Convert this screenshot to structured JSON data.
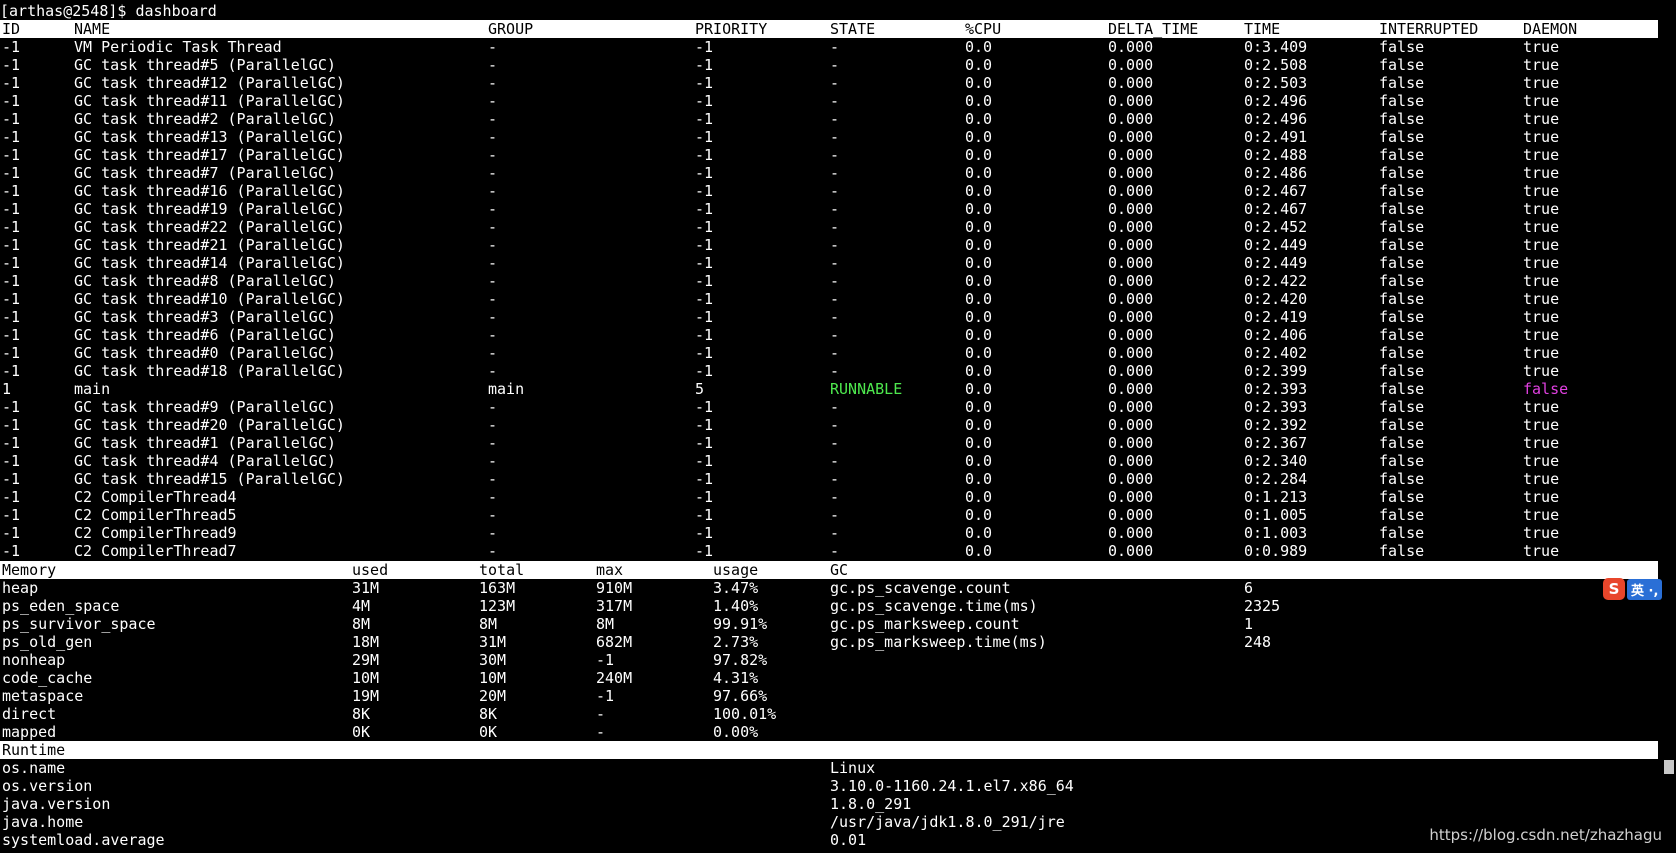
{
  "prompt": "[arthas@2548]$ dashboard",
  "threads": {
    "headers": [
      "ID",
      "NAME",
      "GROUP",
      "PRIORITY",
      "STATE",
      "%CPU",
      "DELTA_TIME",
      "TIME",
      "INTERRUPTED",
      "DAEMON"
    ],
    "rows": [
      [
        "-1",
        "VM Periodic Task Thread",
        "-",
        "-1",
        "-",
        "0.0",
        "0.000",
        "0:3.409",
        "false",
        "true"
      ],
      [
        "-1",
        "GC task thread#5 (ParallelGC)",
        "-",
        "-1",
        "-",
        "0.0",
        "0.000",
        "0:2.508",
        "false",
        "true"
      ],
      [
        "-1",
        "GC task thread#12 (ParallelGC)",
        "-",
        "-1",
        "-",
        "0.0",
        "0.000",
        "0:2.503",
        "false",
        "true"
      ],
      [
        "-1",
        "GC task thread#11 (ParallelGC)",
        "-",
        "-1",
        "-",
        "0.0",
        "0.000",
        "0:2.496",
        "false",
        "true"
      ],
      [
        "-1",
        "GC task thread#2 (ParallelGC)",
        "-",
        "-1",
        "-",
        "0.0",
        "0.000",
        "0:2.496",
        "false",
        "true"
      ],
      [
        "-1",
        "GC task thread#13 (ParallelGC)",
        "-",
        "-1",
        "-",
        "0.0",
        "0.000",
        "0:2.491",
        "false",
        "true"
      ],
      [
        "-1",
        "GC task thread#17 (ParallelGC)",
        "-",
        "-1",
        "-",
        "0.0",
        "0.000",
        "0:2.488",
        "false",
        "true"
      ],
      [
        "-1",
        "GC task thread#7 (ParallelGC)",
        "-",
        "-1",
        "-",
        "0.0",
        "0.000",
        "0:2.486",
        "false",
        "true"
      ],
      [
        "-1",
        "GC task thread#16 (ParallelGC)",
        "-",
        "-1",
        "-",
        "0.0",
        "0.000",
        "0:2.467",
        "false",
        "true"
      ],
      [
        "-1",
        "GC task thread#19 (ParallelGC)",
        "-",
        "-1",
        "-",
        "0.0",
        "0.000",
        "0:2.467",
        "false",
        "true"
      ],
      [
        "-1",
        "GC task thread#22 (ParallelGC)",
        "-",
        "-1",
        "-",
        "0.0",
        "0.000",
        "0:2.452",
        "false",
        "true"
      ],
      [
        "-1",
        "GC task thread#21 (ParallelGC)",
        "-",
        "-1",
        "-",
        "0.0",
        "0.000",
        "0:2.449",
        "false",
        "true"
      ],
      [
        "-1",
        "GC task thread#14 (ParallelGC)",
        "-",
        "-1",
        "-",
        "0.0",
        "0.000",
        "0:2.449",
        "false",
        "true"
      ],
      [
        "-1",
        "GC task thread#8 (ParallelGC)",
        "-",
        "-1",
        "-",
        "0.0",
        "0.000",
        "0:2.422",
        "false",
        "true"
      ],
      [
        "-1",
        "GC task thread#10 (ParallelGC)",
        "-",
        "-1",
        "-",
        "0.0",
        "0.000",
        "0:2.420",
        "false",
        "true"
      ],
      [
        "-1",
        "GC task thread#3 (ParallelGC)",
        "-",
        "-1",
        "-",
        "0.0",
        "0.000",
        "0:2.419",
        "false",
        "true"
      ],
      [
        "-1",
        "GC task thread#6 (ParallelGC)",
        "-",
        "-1",
        "-",
        "0.0",
        "0.000",
        "0:2.406",
        "false",
        "true"
      ],
      [
        "-1",
        "GC task thread#0 (ParallelGC)",
        "-",
        "-1",
        "-",
        "0.0",
        "0.000",
        "0:2.402",
        "false",
        "true"
      ],
      [
        "-1",
        "GC task thread#18 (ParallelGC)",
        "-",
        "-1",
        "-",
        "0.0",
        "0.000",
        "0:2.399",
        "false",
        "true"
      ],
      [
        "1",
        "main",
        "main",
        "5",
        "RUNNABLE",
        "0.0",
        "0.000",
        "0:2.393",
        "false",
        "false"
      ],
      [
        "-1",
        "GC task thread#9 (ParallelGC)",
        "-",
        "-1",
        "-",
        "0.0",
        "0.000",
        "0:2.393",
        "false",
        "true"
      ],
      [
        "-1",
        "GC task thread#20 (ParallelGC)",
        "-",
        "-1",
        "-",
        "0.0",
        "0.000",
        "0:2.392",
        "false",
        "true"
      ],
      [
        "-1",
        "GC task thread#1 (ParallelGC)",
        "-",
        "-1",
        "-",
        "0.0",
        "0.000",
        "0:2.367",
        "false",
        "true"
      ],
      [
        "-1",
        "GC task thread#4 (ParallelGC)",
        "-",
        "-1",
        "-",
        "0.0",
        "0.000",
        "0:2.340",
        "false",
        "true"
      ],
      [
        "-1",
        "GC task thread#15 (ParallelGC)",
        "-",
        "-1",
        "-",
        "0.0",
        "0.000",
        "0:2.284",
        "false",
        "true"
      ],
      [
        "-1",
        "C2 CompilerThread4",
        "-",
        "-1",
        "-",
        "0.0",
        "0.000",
        "0:1.213",
        "false",
        "true"
      ],
      [
        "-1",
        "C2 CompilerThread5",
        "-",
        "-1",
        "-",
        "0.0",
        "0.000",
        "0:1.005",
        "false",
        "true"
      ],
      [
        "-1",
        "C2 CompilerThread9",
        "-",
        "-1",
        "-",
        "0.0",
        "0.000",
        "0:1.003",
        "false",
        "true"
      ],
      [
        "-1",
        "C2 CompilerThread7",
        "-",
        "-1",
        "-",
        "0.0",
        "0.000",
        "0:0.989",
        "false",
        "true"
      ]
    ]
  },
  "memory": {
    "headers": [
      "Memory",
      "used",
      "total",
      "max",
      "usage",
      "GC"
    ],
    "rows": [
      [
        "heap",
        "31M",
        "163M",
        "910M",
        "3.47%"
      ],
      [
        "ps_eden_space",
        "4M",
        "123M",
        "317M",
        "1.40%"
      ],
      [
        "ps_survivor_space",
        "8M",
        "8M",
        "8M",
        "99.91%"
      ],
      [
        "ps_old_gen",
        "18M",
        "31M",
        "682M",
        "2.73%"
      ],
      [
        "nonheap",
        "29M",
        "30M",
        "-1",
        "97.82%"
      ],
      [
        "code_cache",
        "10M",
        "10M",
        "240M",
        "4.31%"
      ],
      [
        "metaspace",
        "19M",
        "20M",
        "-1",
        "97.66%"
      ],
      [
        "direct",
        "8K",
        "8K",
        "-",
        "100.01%"
      ],
      [
        "mapped",
        "0K",
        "0K",
        "-",
        "0.00%"
      ]
    ],
    "gc": [
      [
        "gc.ps_scavenge.count",
        "6"
      ],
      [
        "gc.ps_scavenge.time(ms)",
        "2325"
      ],
      [
        "gc.ps_marksweep.count",
        "1"
      ],
      [
        "gc.ps_marksweep.time(ms)",
        "248"
      ]
    ]
  },
  "runtime": {
    "header": "Runtime",
    "rows": [
      [
        "os.name",
        "Linux"
      ],
      [
        "os.version",
        "3.10.0-1160.24.1.el7.x86_64"
      ],
      [
        "java.version",
        "1.8.0_291"
      ],
      [
        "java.home",
        "/usr/java/jdk1.8.0_291/jre"
      ],
      [
        "systemload.average",
        "0.01"
      ]
    ]
  },
  "ime": {
    "logo": "S",
    "text": "英 ·,"
  },
  "watermark": "https://blog.csdn.net/zhazhagu",
  "colors": {
    "runnable": "#4ee84e",
    "daemon_false": "#e040e0",
    "header_bg": "#ffffff"
  }
}
